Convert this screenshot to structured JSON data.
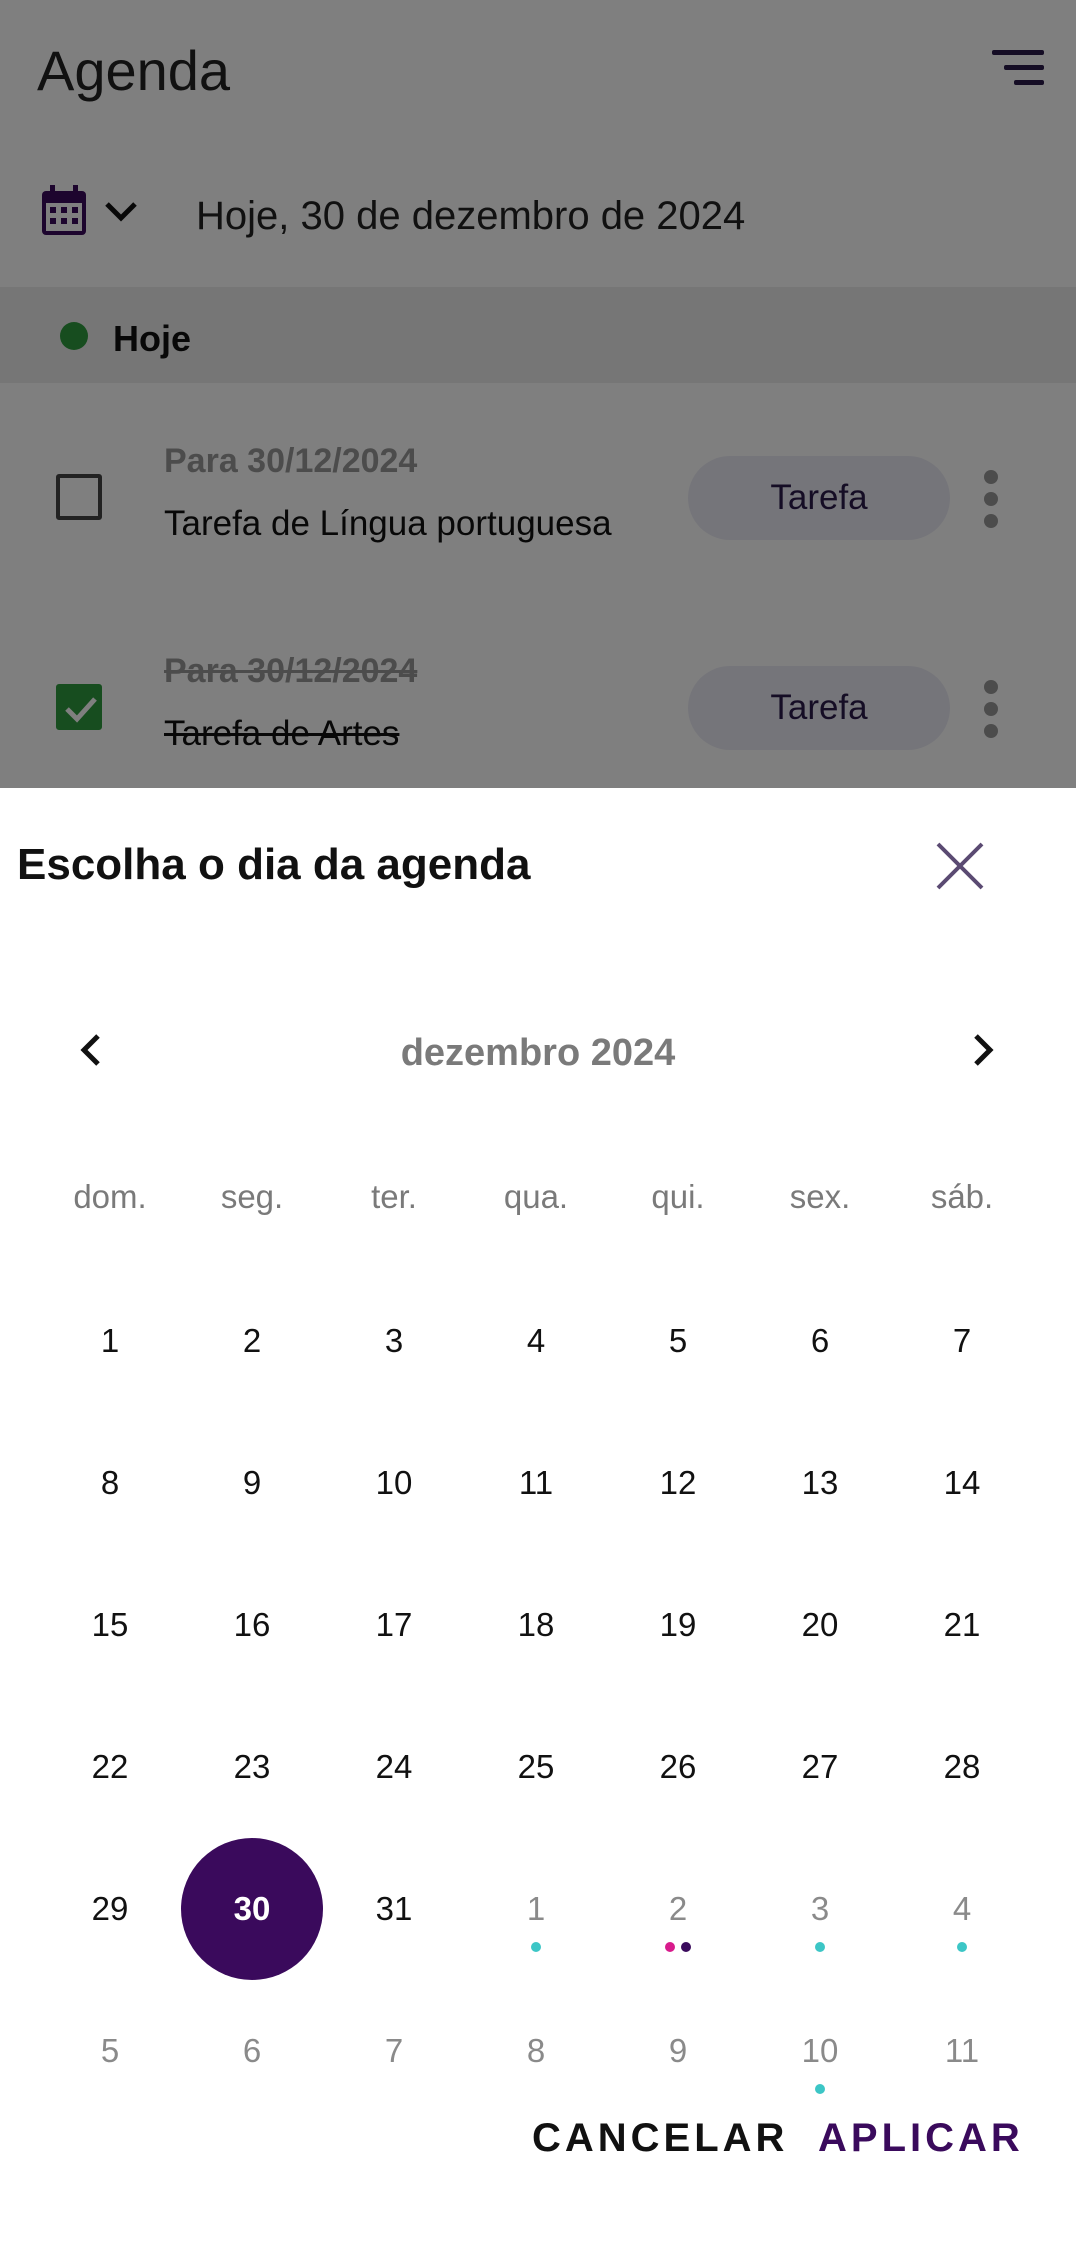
{
  "agenda": {
    "title": "Agenda",
    "date_text": "Hoje, 30 de dezembro de 2024",
    "today_label": "Hoje",
    "tasks": [
      {
        "date": "Para 30/12/2024",
        "name": "Tarefa de Língua portuguesa",
        "tag": "Tarefa",
        "done": false
      },
      {
        "date": "Para 30/12/2024",
        "name": "Tarefa de Artes",
        "tag": "Tarefa",
        "done": true
      }
    ]
  },
  "sheet": {
    "title": "Escolha o dia da agenda",
    "month_label": "dezembro 2024",
    "weekdays": [
      "dom.",
      "seg.",
      "ter.",
      "qua.",
      "qui.",
      "sex.",
      "sáb."
    ],
    "weeks": [
      [
        {
          "d": "1"
        },
        {
          "d": "2"
        },
        {
          "d": "3"
        },
        {
          "d": "4"
        },
        {
          "d": "5"
        },
        {
          "d": "6"
        },
        {
          "d": "7"
        }
      ],
      [
        {
          "d": "8"
        },
        {
          "d": "9"
        },
        {
          "d": "10"
        },
        {
          "d": "11"
        },
        {
          "d": "12"
        },
        {
          "d": "13"
        },
        {
          "d": "14"
        }
      ],
      [
        {
          "d": "15"
        },
        {
          "d": "16"
        },
        {
          "d": "17"
        },
        {
          "d": "18"
        },
        {
          "d": "19"
        },
        {
          "d": "20"
        },
        {
          "d": "21"
        }
      ],
      [
        {
          "d": "22"
        },
        {
          "d": "23"
        },
        {
          "d": "24"
        },
        {
          "d": "25"
        },
        {
          "d": "26"
        },
        {
          "d": "27"
        },
        {
          "d": "28"
        }
      ],
      [
        {
          "d": "29"
        },
        {
          "d": "30",
          "selected": true
        },
        {
          "d": "31"
        },
        {
          "d": "1",
          "other": true,
          "dots": [
            "#3cc6c6"
          ]
        },
        {
          "d": "2",
          "other": true,
          "dots": [
            "#d81b8c",
            "#3a0a5c"
          ]
        },
        {
          "d": "3",
          "other": true,
          "dots": [
            "#3cc6c6"
          ]
        },
        {
          "d": "4",
          "other": true,
          "dots": [
            "#3cc6c6"
          ]
        }
      ],
      [
        {
          "d": "5",
          "other": true
        },
        {
          "d": "6",
          "other": true
        },
        {
          "d": "7",
          "other": true
        },
        {
          "d": "8",
          "other": true
        },
        {
          "d": "9",
          "other": true
        },
        {
          "d": "10",
          "other": true,
          "dots": [
            "#3cc6c6"
          ]
        },
        {
          "d": "11",
          "other": true
        }
      ]
    ],
    "cancel_label": "CANCELAR",
    "apply_label": "APLICAR"
  },
  "colors": {
    "accent": "#3a0a5c",
    "today_dot": "#2e9a3e",
    "event_teal": "#3cc6c6",
    "event_pink": "#d81b8c"
  }
}
